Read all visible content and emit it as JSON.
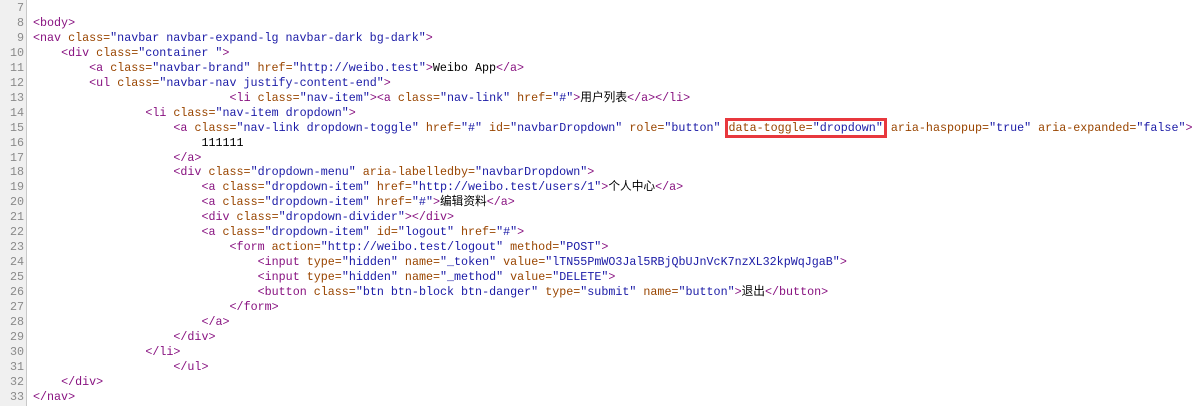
{
  "colors": {
    "tag": "#881280",
    "attr": "#994500",
    "value": "#1a1aa6",
    "highlight": "#e8383d"
  },
  "lines": [
    {
      "n": "7",
      "indent": 0,
      "tokens": []
    },
    {
      "n": "8",
      "indent": 0,
      "tokens": [
        [
          "t",
          "<body>"
        ]
      ]
    },
    {
      "n": "9",
      "indent": 0,
      "tokens": [
        [
          "t",
          "<nav "
        ],
        [
          "a",
          "class="
        ],
        [
          "v",
          "\"navbar navbar-expand-lg navbar-dark bg-dark\""
        ],
        [
          "t",
          ">"
        ]
      ]
    },
    {
      "n": "10",
      "indent": 4,
      "tokens": [
        [
          "t",
          "<div "
        ],
        [
          "a",
          "class="
        ],
        [
          "v",
          "\"container \""
        ],
        [
          "t",
          ">"
        ]
      ]
    },
    {
      "n": "11",
      "indent": 8,
      "tokens": [
        [
          "t",
          "<a "
        ],
        [
          "a",
          "class="
        ],
        [
          "v",
          "\"navbar-brand\""
        ],
        [
          "a",
          " href="
        ],
        [
          "v",
          "\"http://weibo.test\""
        ],
        [
          "t",
          ">"
        ],
        [
          "x",
          "Weibo App"
        ],
        [
          "t",
          "</a>"
        ]
      ]
    },
    {
      "n": "12",
      "indent": 8,
      "tokens": [
        [
          "t",
          "<ul "
        ],
        [
          "a",
          "class="
        ],
        [
          "v",
          "\"navbar-nav justify-content-end\""
        ],
        [
          "t",
          ">"
        ]
      ]
    },
    {
      "n": "13",
      "indent": 28,
      "tokens": [
        [
          "t",
          "<li "
        ],
        [
          "a",
          "class="
        ],
        [
          "v",
          "\"nav-item\""
        ],
        [
          "t",
          "><a "
        ],
        [
          "a",
          "class="
        ],
        [
          "v",
          "\"nav-link\""
        ],
        [
          "a",
          " href="
        ],
        [
          "v",
          "\"#\""
        ],
        [
          "t",
          ">"
        ],
        [
          "x",
          "用户列表"
        ],
        [
          "t",
          "</a></li>"
        ]
      ]
    },
    {
      "n": "14",
      "indent": 16,
      "tokens": [
        [
          "t",
          "<li "
        ],
        [
          "a",
          "class="
        ],
        [
          "v",
          "\"nav-item dropdown\""
        ],
        [
          "t",
          ">"
        ]
      ]
    },
    {
      "n": "15",
      "indent": 20,
      "tokens": [
        [
          "t",
          "<a "
        ],
        [
          "a",
          "class="
        ],
        [
          "v",
          "\"nav-link dropdown-toggle\""
        ],
        [
          "a",
          " href="
        ],
        [
          "v",
          "\"#\""
        ],
        [
          "a",
          " id="
        ],
        [
          "v",
          "\"navbarDropdown\""
        ],
        [
          "a",
          " role="
        ],
        [
          "v",
          "\"button\""
        ],
        [
          "x",
          " "
        ],
        [
          "box",
          [
            [
              "a",
              "data-toggle="
            ],
            [
              "v",
              "\"dropdown\""
            ]
          ]
        ],
        [
          "a",
          " aria-haspopup="
        ],
        [
          "v",
          "\"true\""
        ],
        [
          "a",
          " aria-expanded="
        ],
        [
          "v",
          "\"false\""
        ],
        [
          "t",
          ">"
        ]
      ]
    },
    {
      "n": "16",
      "indent": 24,
      "tokens": [
        [
          "x",
          "111111"
        ]
      ]
    },
    {
      "n": "17",
      "indent": 20,
      "tokens": [
        [
          "t",
          "</a>"
        ]
      ]
    },
    {
      "n": "18",
      "indent": 20,
      "tokens": [
        [
          "t",
          "<div "
        ],
        [
          "a",
          "class="
        ],
        [
          "v",
          "\"dropdown-menu\""
        ],
        [
          "a",
          " aria-labelledby="
        ],
        [
          "v",
          "\"navbarDropdown\""
        ],
        [
          "t",
          ">"
        ]
      ]
    },
    {
      "n": "19",
      "indent": 24,
      "tokens": [
        [
          "t",
          "<a "
        ],
        [
          "a",
          "class="
        ],
        [
          "v",
          "\"dropdown-item\""
        ],
        [
          "a",
          " href="
        ],
        [
          "v",
          "\"http://weibo.test/users/1\""
        ],
        [
          "t",
          ">"
        ],
        [
          "x",
          "个人中心"
        ],
        [
          "t",
          "</a>"
        ]
      ]
    },
    {
      "n": "20",
      "indent": 24,
      "tokens": [
        [
          "t",
          "<a "
        ],
        [
          "a",
          "class="
        ],
        [
          "v",
          "\"dropdown-item\""
        ],
        [
          "a",
          " href="
        ],
        [
          "v",
          "\"#\""
        ],
        [
          "t",
          ">"
        ],
        [
          "x",
          "编辑资料"
        ],
        [
          "t",
          "</a>"
        ]
      ]
    },
    {
      "n": "21",
      "indent": 24,
      "tokens": [
        [
          "t",
          "<div "
        ],
        [
          "a",
          "class="
        ],
        [
          "v",
          "\"dropdown-divider\""
        ],
        [
          "t",
          "></div>"
        ]
      ]
    },
    {
      "n": "22",
      "indent": 24,
      "tokens": [
        [
          "t",
          "<a "
        ],
        [
          "a",
          "class="
        ],
        [
          "v",
          "\"dropdown-item\""
        ],
        [
          "a",
          " id="
        ],
        [
          "v",
          "\"logout\""
        ],
        [
          "a",
          " href="
        ],
        [
          "v",
          "\"#\""
        ],
        [
          "t",
          ">"
        ]
      ]
    },
    {
      "n": "23",
      "indent": 28,
      "tokens": [
        [
          "t",
          "<form "
        ],
        [
          "a",
          "action="
        ],
        [
          "v",
          "\"http://weibo.test/logout\""
        ],
        [
          "a",
          " method="
        ],
        [
          "v",
          "\"POST\""
        ],
        [
          "t",
          ">"
        ]
      ]
    },
    {
      "n": "24",
      "indent": 32,
      "tokens": [
        [
          "t",
          "<input "
        ],
        [
          "a",
          "type="
        ],
        [
          "v",
          "\"hidden\""
        ],
        [
          "a",
          " name="
        ],
        [
          "v",
          "\"_token\""
        ],
        [
          "a",
          " value="
        ],
        [
          "v",
          "\"lTN55PmWO3Jal5RBjQbUJnVcK7nzXL32kpWqJgaB\""
        ],
        [
          "t",
          ">"
        ]
      ]
    },
    {
      "n": "25",
      "indent": 32,
      "tokens": [
        [
          "t",
          "<input "
        ],
        [
          "a",
          "type="
        ],
        [
          "v",
          "\"hidden\""
        ],
        [
          "a",
          " name="
        ],
        [
          "v",
          "\"_method\""
        ],
        [
          "a",
          " value="
        ],
        [
          "v",
          "\"DELETE\""
        ],
        [
          "t",
          ">"
        ]
      ]
    },
    {
      "n": "26",
      "indent": 32,
      "tokens": [
        [
          "t",
          "<button "
        ],
        [
          "a",
          "class="
        ],
        [
          "v",
          "\"btn btn-block btn-danger\""
        ],
        [
          "a",
          " type="
        ],
        [
          "v",
          "\"submit\""
        ],
        [
          "a",
          " name="
        ],
        [
          "v",
          "\"button\""
        ],
        [
          "t",
          ">"
        ],
        [
          "x",
          "退出"
        ],
        [
          "t",
          "</button>"
        ]
      ]
    },
    {
      "n": "27",
      "indent": 28,
      "tokens": [
        [
          "t",
          "</form>"
        ]
      ]
    },
    {
      "n": "28",
      "indent": 24,
      "tokens": [
        [
          "t",
          "</a>"
        ]
      ]
    },
    {
      "n": "29",
      "indent": 20,
      "tokens": [
        [
          "t",
          "</div>"
        ]
      ]
    },
    {
      "n": "30",
      "indent": 16,
      "tokens": [
        [
          "t",
          "</li>"
        ]
      ]
    },
    {
      "n": "31",
      "indent": 20,
      "tokens": [
        [
          "t",
          "</ul>"
        ]
      ]
    },
    {
      "n": "32",
      "indent": 4,
      "tokens": [
        [
          "t",
          "</div>"
        ]
      ]
    },
    {
      "n": "33",
      "indent": 0,
      "tokens": [
        [
          "t",
          "</nav>"
        ]
      ]
    }
  ]
}
